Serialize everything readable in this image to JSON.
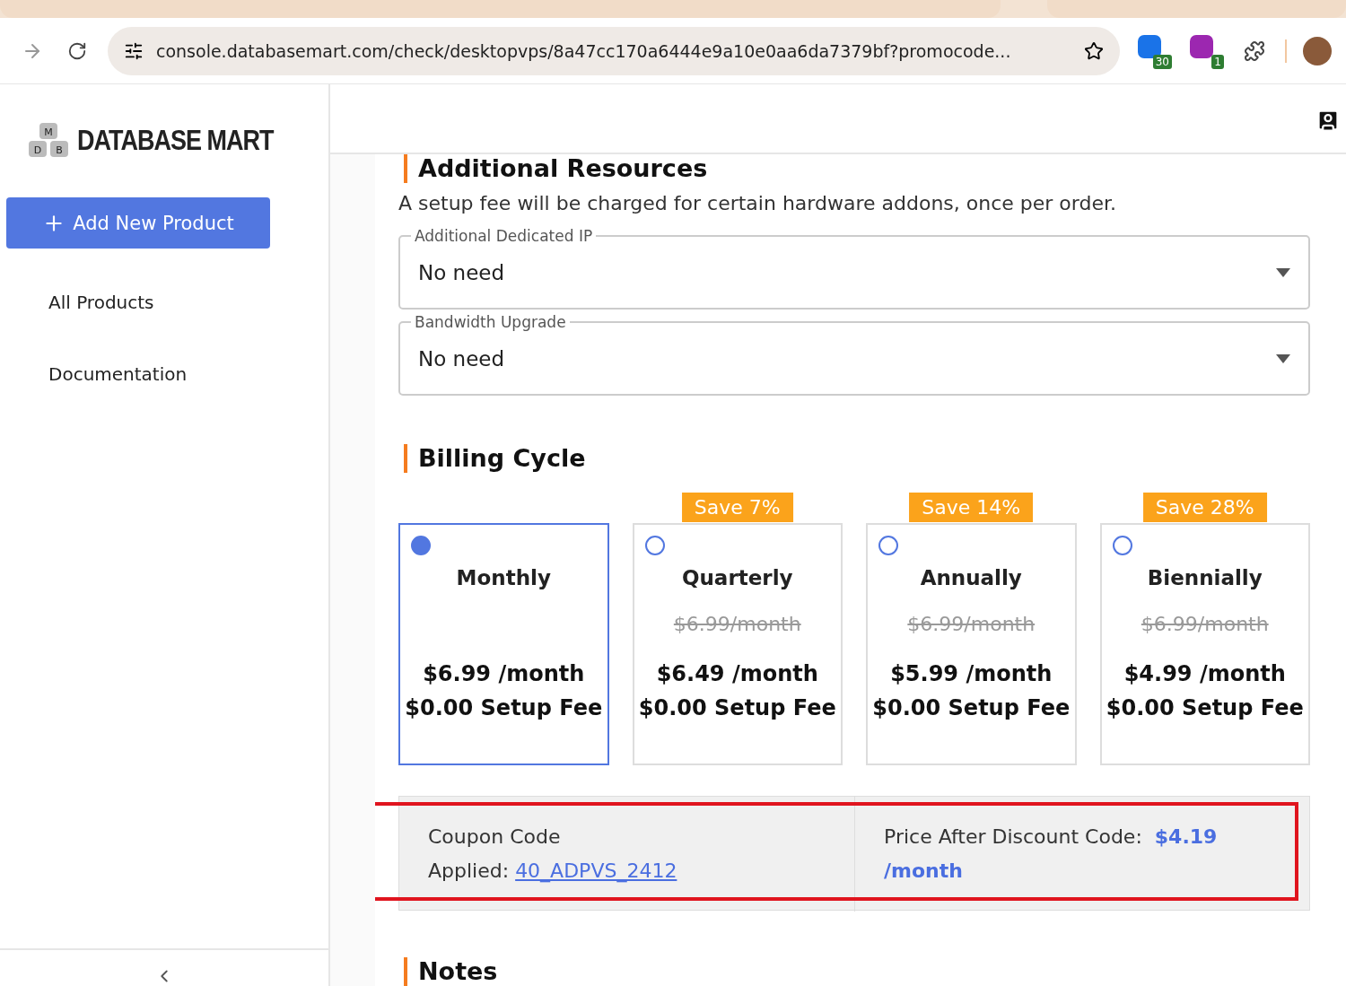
{
  "browser": {
    "url": "console.databasemart.com/check/desktopvps/8a47cc170a6444e9a10e0aa6da7379bf?promocode...",
    "extensions": [
      {
        "badge": "30",
        "color": "#1a73e8"
      },
      {
        "badge": "1",
        "color": "#9c27b0"
      }
    ]
  },
  "sidebar": {
    "logo": {
      "letters": [
        "M",
        "D",
        "B"
      ],
      "text": "DATABASE MART"
    },
    "add_button": "Add New Product",
    "items": [
      {
        "label": "All Products"
      },
      {
        "label": "Documentation"
      }
    ]
  },
  "additional_resources": {
    "title": "Additional Resources",
    "note": "A setup fee will be charged for certain hardware addons, once per order.",
    "selects": [
      {
        "label": "Additional Dedicated IP",
        "value": "No need"
      },
      {
        "label": "Bandwidth Upgrade",
        "value": "No need"
      }
    ]
  },
  "billing": {
    "title": "Billing Cycle",
    "options": [
      {
        "name": "Monthly",
        "selected": true,
        "price": "$6.99 /month",
        "setup": "$0.00 Setup Fee"
      },
      {
        "name": "Quarterly",
        "selected": false,
        "badge": "Save 7%",
        "old_price": "$6.99/month",
        "price": "$6.49 /month",
        "setup": "$0.00 Setup Fee"
      },
      {
        "name": "Annually",
        "selected": false,
        "badge": "Save 14%",
        "old_price": "$6.99/month",
        "price": "$5.99 /month",
        "setup": "$0.00 Setup Fee"
      },
      {
        "name": "Biennially",
        "selected": false,
        "badge": "Save 28%",
        "old_price": "$6.99/month",
        "price": "$4.99 /month",
        "setup": "$0.00 Setup Fee"
      }
    ]
  },
  "coupon": {
    "label": "Coupon Code Applied:",
    "code": "40_ADPVS_2412",
    "price_label": "Price After Discount Code:",
    "price": "$4.19 /month",
    "highlighted": true
  },
  "notes": {
    "title": "Notes"
  }
}
